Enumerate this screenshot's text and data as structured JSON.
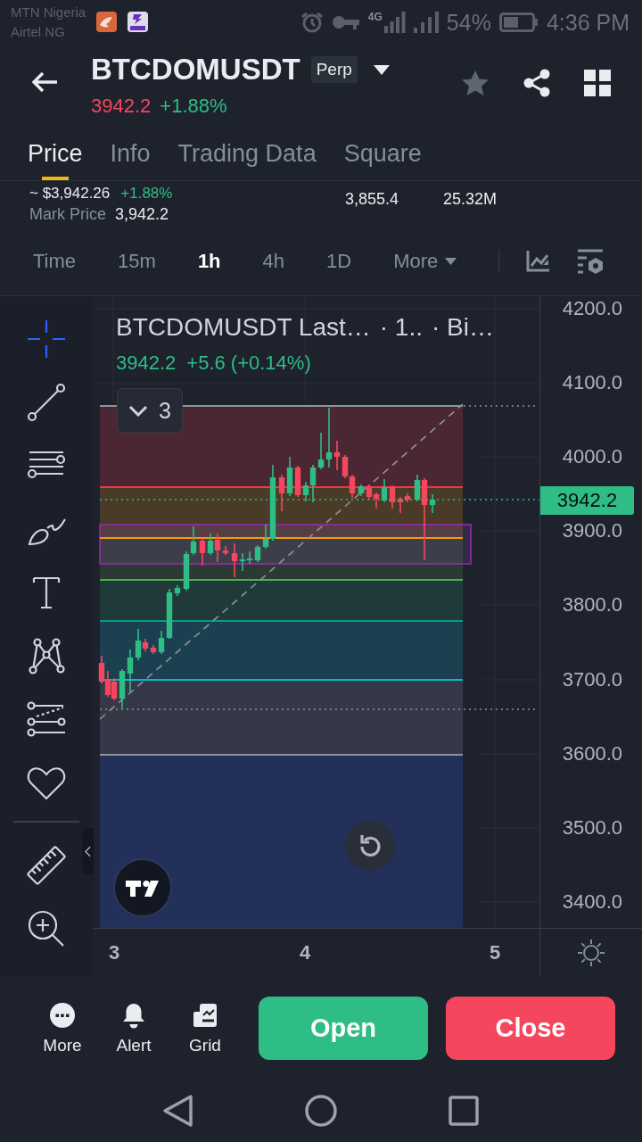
{
  "status_bar": {
    "carriers": [
      "MTN Nigeria",
      "Airtel NG"
    ],
    "network": "4G",
    "battery": "54%",
    "time": "4:36 PM"
  },
  "header": {
    "symbol": "BTCDOMUSDT",
    "badge": "Perp",
    "price": "3942.2",
    "falling": true,
    "change": "+1.88%"
  },
  "tabs": [
    {
      "label": "Price",
      "selected": true
    },
    {
      "label": "Info",
      "selected": false
    },
    {
      "label": "Trading Data",
      "selected": false
    },
    {
      "label": "Square",
      "selected": false
    }
  ],
  "price_summary": {
    "usd_price": "~ $3,942.26",
    "usd_change": "+1.88%",
    "mark_label": "Mark Price",
    "mark_price": "3,942.2",
    "stats": [
      "3,855.4",
      "25.32M"
    ]
  },
  "intervals": [
    {
      "label": "Time",
      "selected": false
    },
    {
      "label": "15m",
      "selected": false
    },
    {
      "label": "1h",
      "selected": true
    },
    {
      "label": "4h",
      "selected": false
    },
    {
      "label": "1D",
      "selected": false
    }
  ],
  "more_menu": {
    "label": "More"
  },
  "drawing_tools": [
    {
      "kind": "crosshair",
      "selected": true
    },
    {
      "kind": "trend-line",
      "selected": false
    },
    {
      "kind": "fib",
      "selected": false
    },
    {
      "kind": "brush",
      "selected": false
    },
    {
      "kind": "text",
      "selected": false
    },
    {
      "kind": "pattern",
      "selected": false
    },
    {
      "kind": "projection",
      "selected": false
    },
    {
      "kind": "favorites",
      "selected": false
    }
  ],
  "measure_tools": [
    {
      "kind": "ruler"
    },
    {
      "kind": "zoom"
    }
  ],
  "chart": {
    "legend": {
      "symbol": "BTCDOMUSDT Last…",
      "interval": "· 1..",
      "source": "· Bi…",
      "price": "3942.2",
      "change": "+5.6 (+0.14%)"
    },
    "drawings_count": "3",
    "price_axis": [
      "4200.0",
      "4100.0",
      "4000.0",
      "3900.0",
      "3800.0",
      "3700.0",
      "3600.0",
      "3500.0",
      "3400.0"
    ],
    "price_tag": "3942.2",
    "time_axis": [
      "3",
      "4",
      "5"
    ]
  },
  "action_bar": {
    "items": [
      {
        "label": "More",
        "kind": "more"
      },
      {
        "label": "Alert",
        "kind": "alert"
      },
      {
        "label": "Grid",
        "kind": "grid"
      }
    ],
    "buttons": [
      {
        "label": "Open",
        "kind": "open"
      },
      {
        "label": "Close",
        "kind": "close"
      }
    ]
  }
}
